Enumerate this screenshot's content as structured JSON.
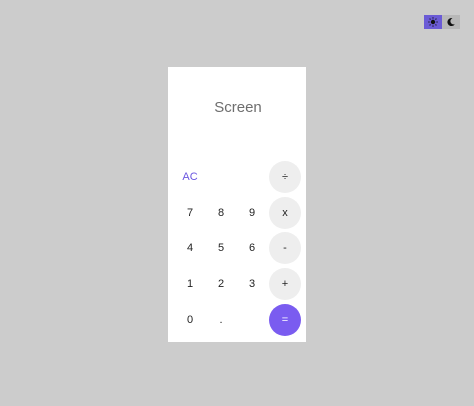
{
  "theme_toggle": {
    "light_icon": "sun-icon",
    "dark_icon": "moon-icon",
    "active_color": "#6b5bd6"
  },
  "calculator": {
    "screen_text": "Screen",
    "keys": {
      "ac": "AC",
      "divide": "÷",
      "seven": "7",
      "eight": "8",
      "nine": "9",
      "multiply": "x",
      "four": "4",
      "five": "5",
      "six": "6",
      "subtract": "-",
      "one": "1",
      "two": "2",
      "three": "3",
      "add": "+",
      "zero": "0",
      "decimal": ".",
      "equals": "="
    },
    "accent_color": "#7a5cf0"
  }
}
